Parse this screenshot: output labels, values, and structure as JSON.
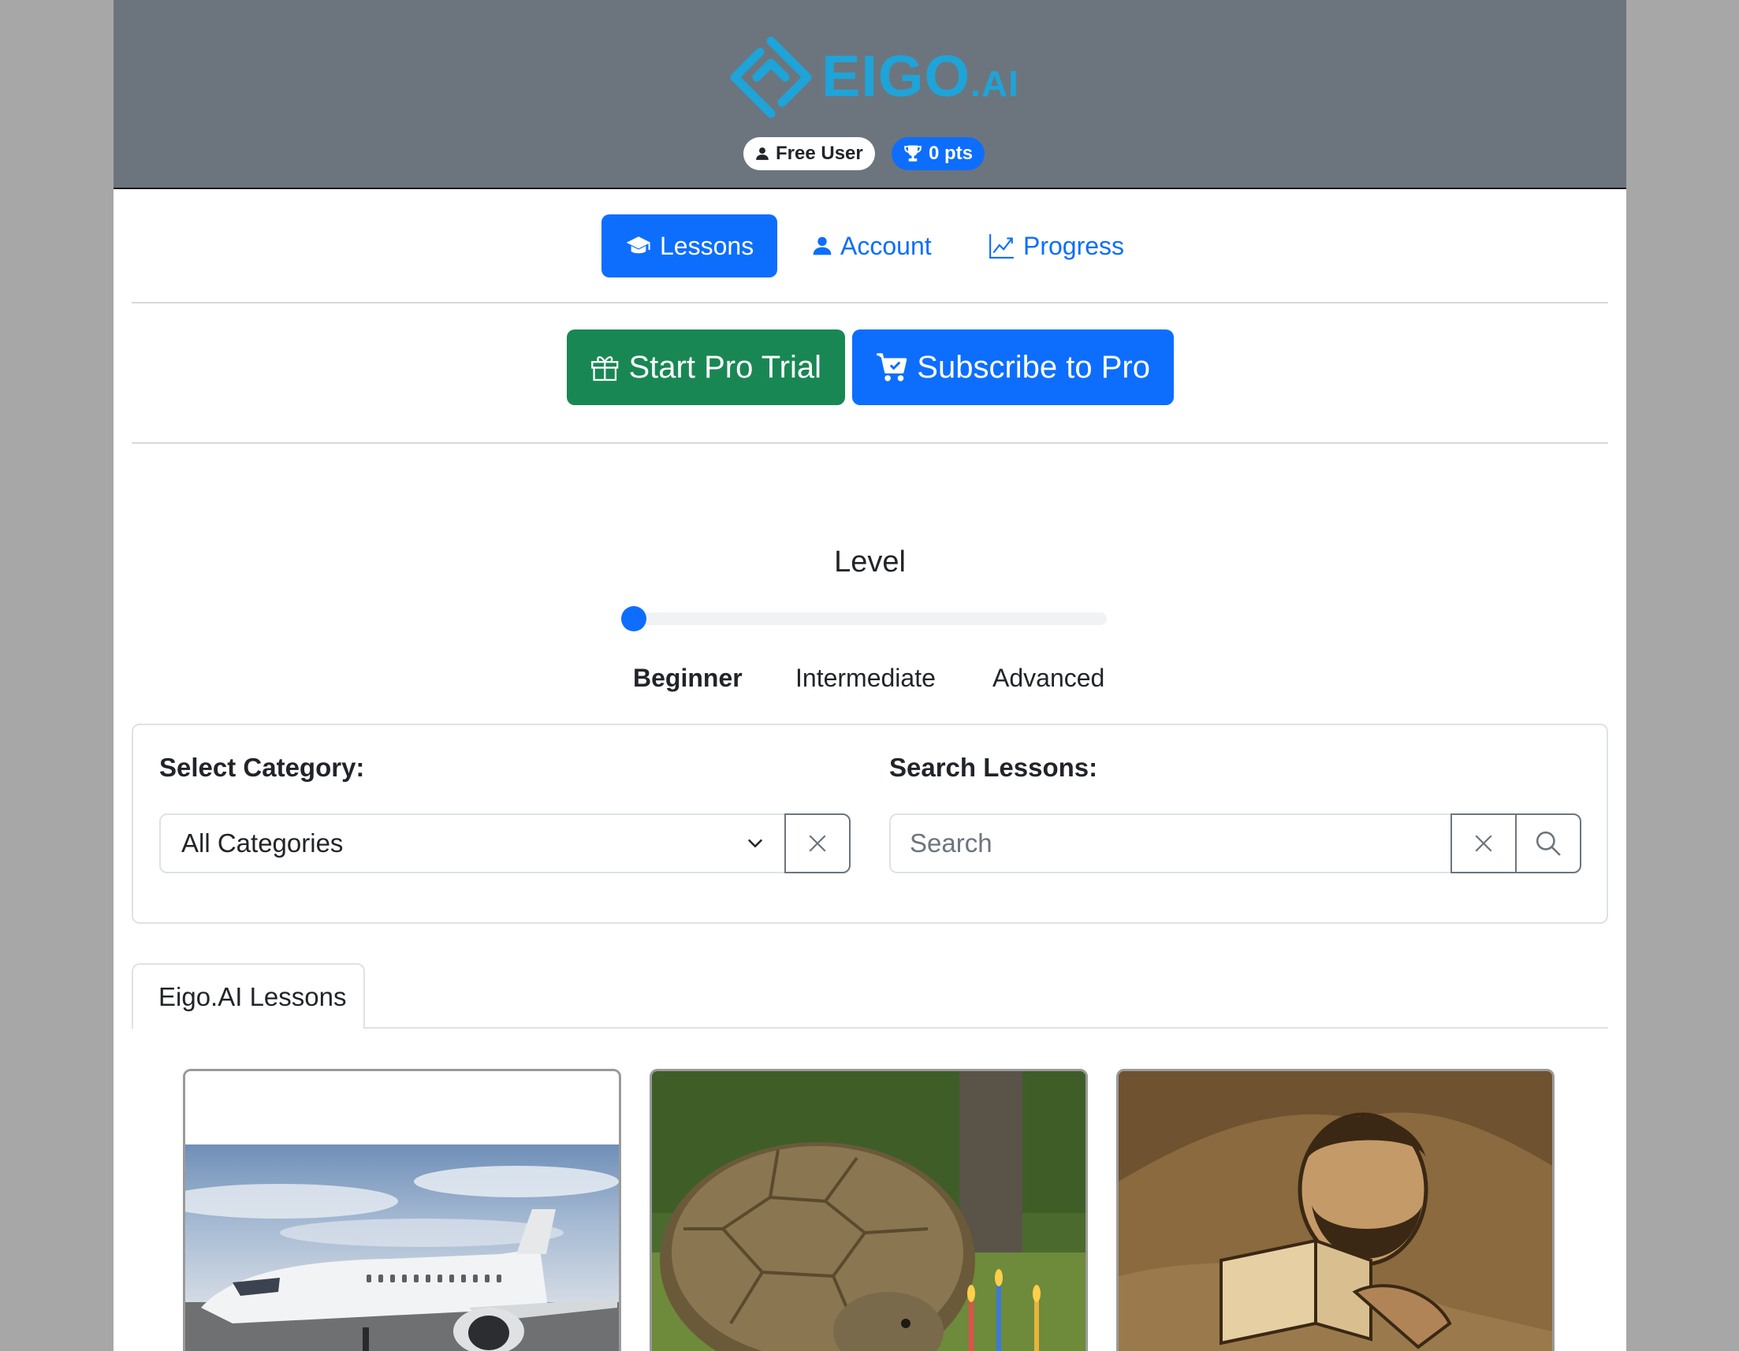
{
  "brand": {
    "logo_text": "EIGO",
    "logo_suffix": ".AI",
    "color": "#1ea4d8"
  },
  "header": {
    "user_badge": {
      "icon": "person-icon",
      "label": "Free User"
    },
    "points_badge": {
      "icon": "trophy-icon",
      "label": "0 pts"
    }
  },
  "nav": {
    "items": [
      {
        "icon": "mortarboard-icon",
        "label": "Lessons",
        "active": true
      },
      {
        "icon": "person-icon",
        "label": "Account",
        "active": false
      },
      {
        "icon": "graph-up-icon",
        "label": "Progress",
        "active": false
      }
    ]
  },
  "cta": {
    "trial": {
      "icon": "gift-icon",
      "label": "Start Pro Trial",
      "color": "#198754"
    },
    "subscribe": {
      "icon": "cart-icon",
      "label": "Subscribe to Pro",
      "color": "#0d6efd"
    }
  },
  "level": {
    "title": "Level",
    "options": [
      "Beginner",
      "Intermediate",
      "Advanced"
    ],
    "selected": "Beginner",
    "slider_value": 0
  },
  "filters": {
    "category_label": "Select Category:",
    "category_value": "All Categories",
    "search_label": "Search Lessons:",
    "search_placeholder": "Search",
    "search_value": ""
  },
  "tabs": [
    {
      "label": "Eigo.AI Lessons",
      "active": true
    }
  ],
  "lessons": [
    {
      "image": "airplane"
    },
    {
      "image": "tortoise-birthday-cake"
    },
    {
      "image": "man-reading-book"
    }
  ],
  "colors": {
    "primary": "#0d6efd",
    "success": "#198754",
    "header_bg": "#6c757d"
  }
}
